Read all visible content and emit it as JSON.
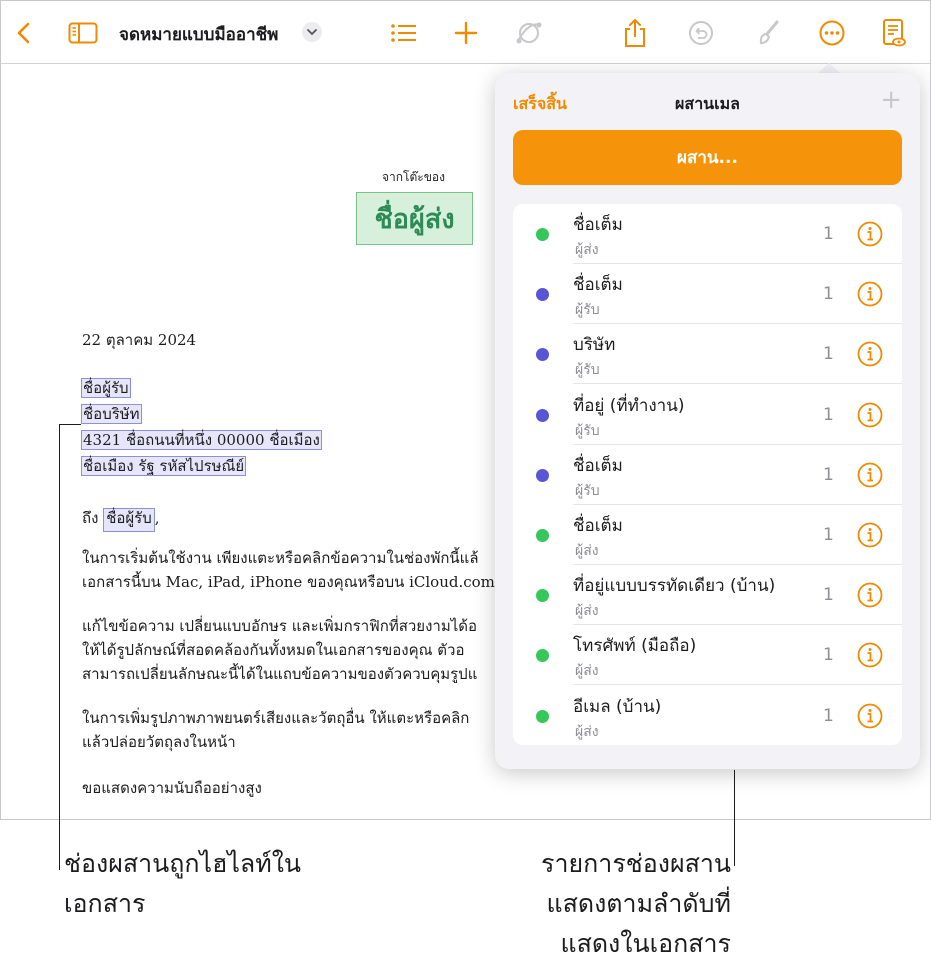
{
  "toolbar": {
    "doc_title": "จดหมายแบบมืออาชีพ",
    "icons": [
      "chevron-left-icon",
      "sidebar-icon",
      "chevron-down-icon",
      "list-icon",
      "plus-icon",
      "shapes-icon",
      "share-icon",
      "undo-icon",
      "paintbrush-icon",
      "more-icon",
      "document-view-icon"
    ]
  },
  "document": {
    "sender_caption": "จากโต๊ะของ",
    "sender_field": "ชื่อผู้ส่ง",
    "date": "22 ตุลาคม 2024",
    "recipient_name": "ชื่อผู้รับ",
    "company_name": "ชื่อบริษัท",
    "address_line1": "4321 ชื่อถนนที่หนึ่ง 00000 ชื่อเมือง",
    "address_line2": "ชื่อเมือง รัฐ รหัสไปรษณีย์",
    "greeting_prefix": "ถึง",
    "greeting_field": "ชื่อผู้รับ",
    "greeting_suffix": ",",
    "para1": [
      "ในการเริ่มต้นใช้งาน เพียงแตะหรือคลิกข้อความในช่องพักนี้แล้",
      "เอกสารนี้บน Mac, iPad, iPhone ของคุณหรือบน iCloud.com"
    ],
    "para2": [
      "แก้ไขข้อความ เปลี่ยนแบบอักษร และเพิ่มกราฟิกที่สวยงามได้อ",
      "ให้ได้รูปลักษณ์ที่สอดคล้องกันทั้งหมดในเอกสารของคุณ ตัวอ",
      "สามารถเปลี่ยนลักษณะนี้ได้ในแถบข้อความของตัวควบคุมรูปแ"
    ],
    "para3": [
      "ในการเพิ่มรูปภาพภาพยนตร์เสียงและวัตถุอื่น ให้แตะหรือคลิก",
      "แล้วปล่อยวัตถุลงในหน้า"
    ],
    "closing": "ขอแสดงความนับถืออย่างสูง"
  },
  "popover": {
    "done_label": "เสร็จสิ้น",
    "title": "ผสานเมล",
    "add_label": "+",
    "merge_button_label": "ผสาน...",
    "fields": [
      {
        "name": "ชื่อเต็ม",
        "source": "ผู้ส่ง",
        "count": "1",
        "color": "#34c759"
      },
      {
        "name": "ชื่อเต็ม",
        "source": "ผู้รับ",
        "count": "1",
        "color": "#5856d6"
      },
      {
        "name": "บริษัท",
        "source": "ผู้รับ",
        "count": "1",
        "color": "#5856d6"
      },
      {
        "name": "ที่อยู่ (ที่ทำงาน)",
        "source": "ผู้รับ",
        "count": "1",
        "color": "#5856d6"
      },
      {
        "name": "ชื่อเต็ม",
        "source": "ผู้รับ",
        "count": "1",
        "color": "#5856d6"
      },
      {
        "name": "ชื่อเต็ม",
        "source": "ผู้ส่ง",
        "count": "1",
        "color": "#34c759"
      },
      {
        "name": "ที่อยู่แบบบรรทัดเดียว (บ้าน)",
        "source": "ผู้ส่ง",
        "count": "1",
        "color": "#34c759"
      },
      {
        "name": "โทรศัพท์ (มือถือ)",
        "source": "ผู้ส่ง",
        "count": "1",
        "color": "#34c759"
      },
      {
        "name": "อีเมล (บ้าน)",
        "source": "ผู้ส่ง",
        "count": "1",
        "color": "#34c759"
      }
    ]
  },
  "callouts": {
    "left": [
      "ช่องผสานถูกไฮไลท์ใน",
      "เอกสาร"
    ],
    "right": [
      "รายการช่องผสาน",
      "แสดงตามลำดับที่",
      "แสดงในเอกสาร"
    ]
  },
  "colors": {
    "accent": "#f08a00",
    "toolbar_icon": "#f08a00",
    "sender_field_bg": "#d7f0dc",
    "recipient_field_bg": "#e6e6fa"
  }
}
